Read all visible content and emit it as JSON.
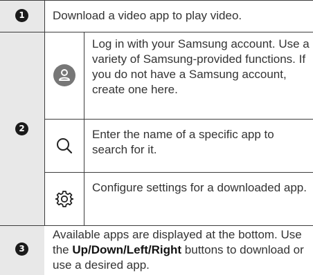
{
  "rows": [
    {
      "number": "1",
      "text": "Download a video app to play video."
    },
    {
      "number": "2",
      "items": [
        {
          "icon": "user-icon",
          "text": "Log in with your Samsung account. Use a variety of Samsung-provided functions. If you do not have a Samsung account, create one here."
        },
        {
          "icon": "search-icon",
          "text": "Enter the name of a specific app to search for it."
        },
        {
          "icon": "gear-icon",
          "text": "Configure settings for a downloaded app."
        }
      ]
    },
    {
      "number": "3",
      "text_before": "Available apps are displayed at the bottom. Use the ",
      "text_bold": "Up/Down/Left/Right",
      "text_after": " buttons to download or use a desired app."
    }
  ],
  "colors": {
    "number_column": "#e8e8e8",
    "user_icon_circle": "#777777",
    "badge": "#1a1a1a"
  }
}
